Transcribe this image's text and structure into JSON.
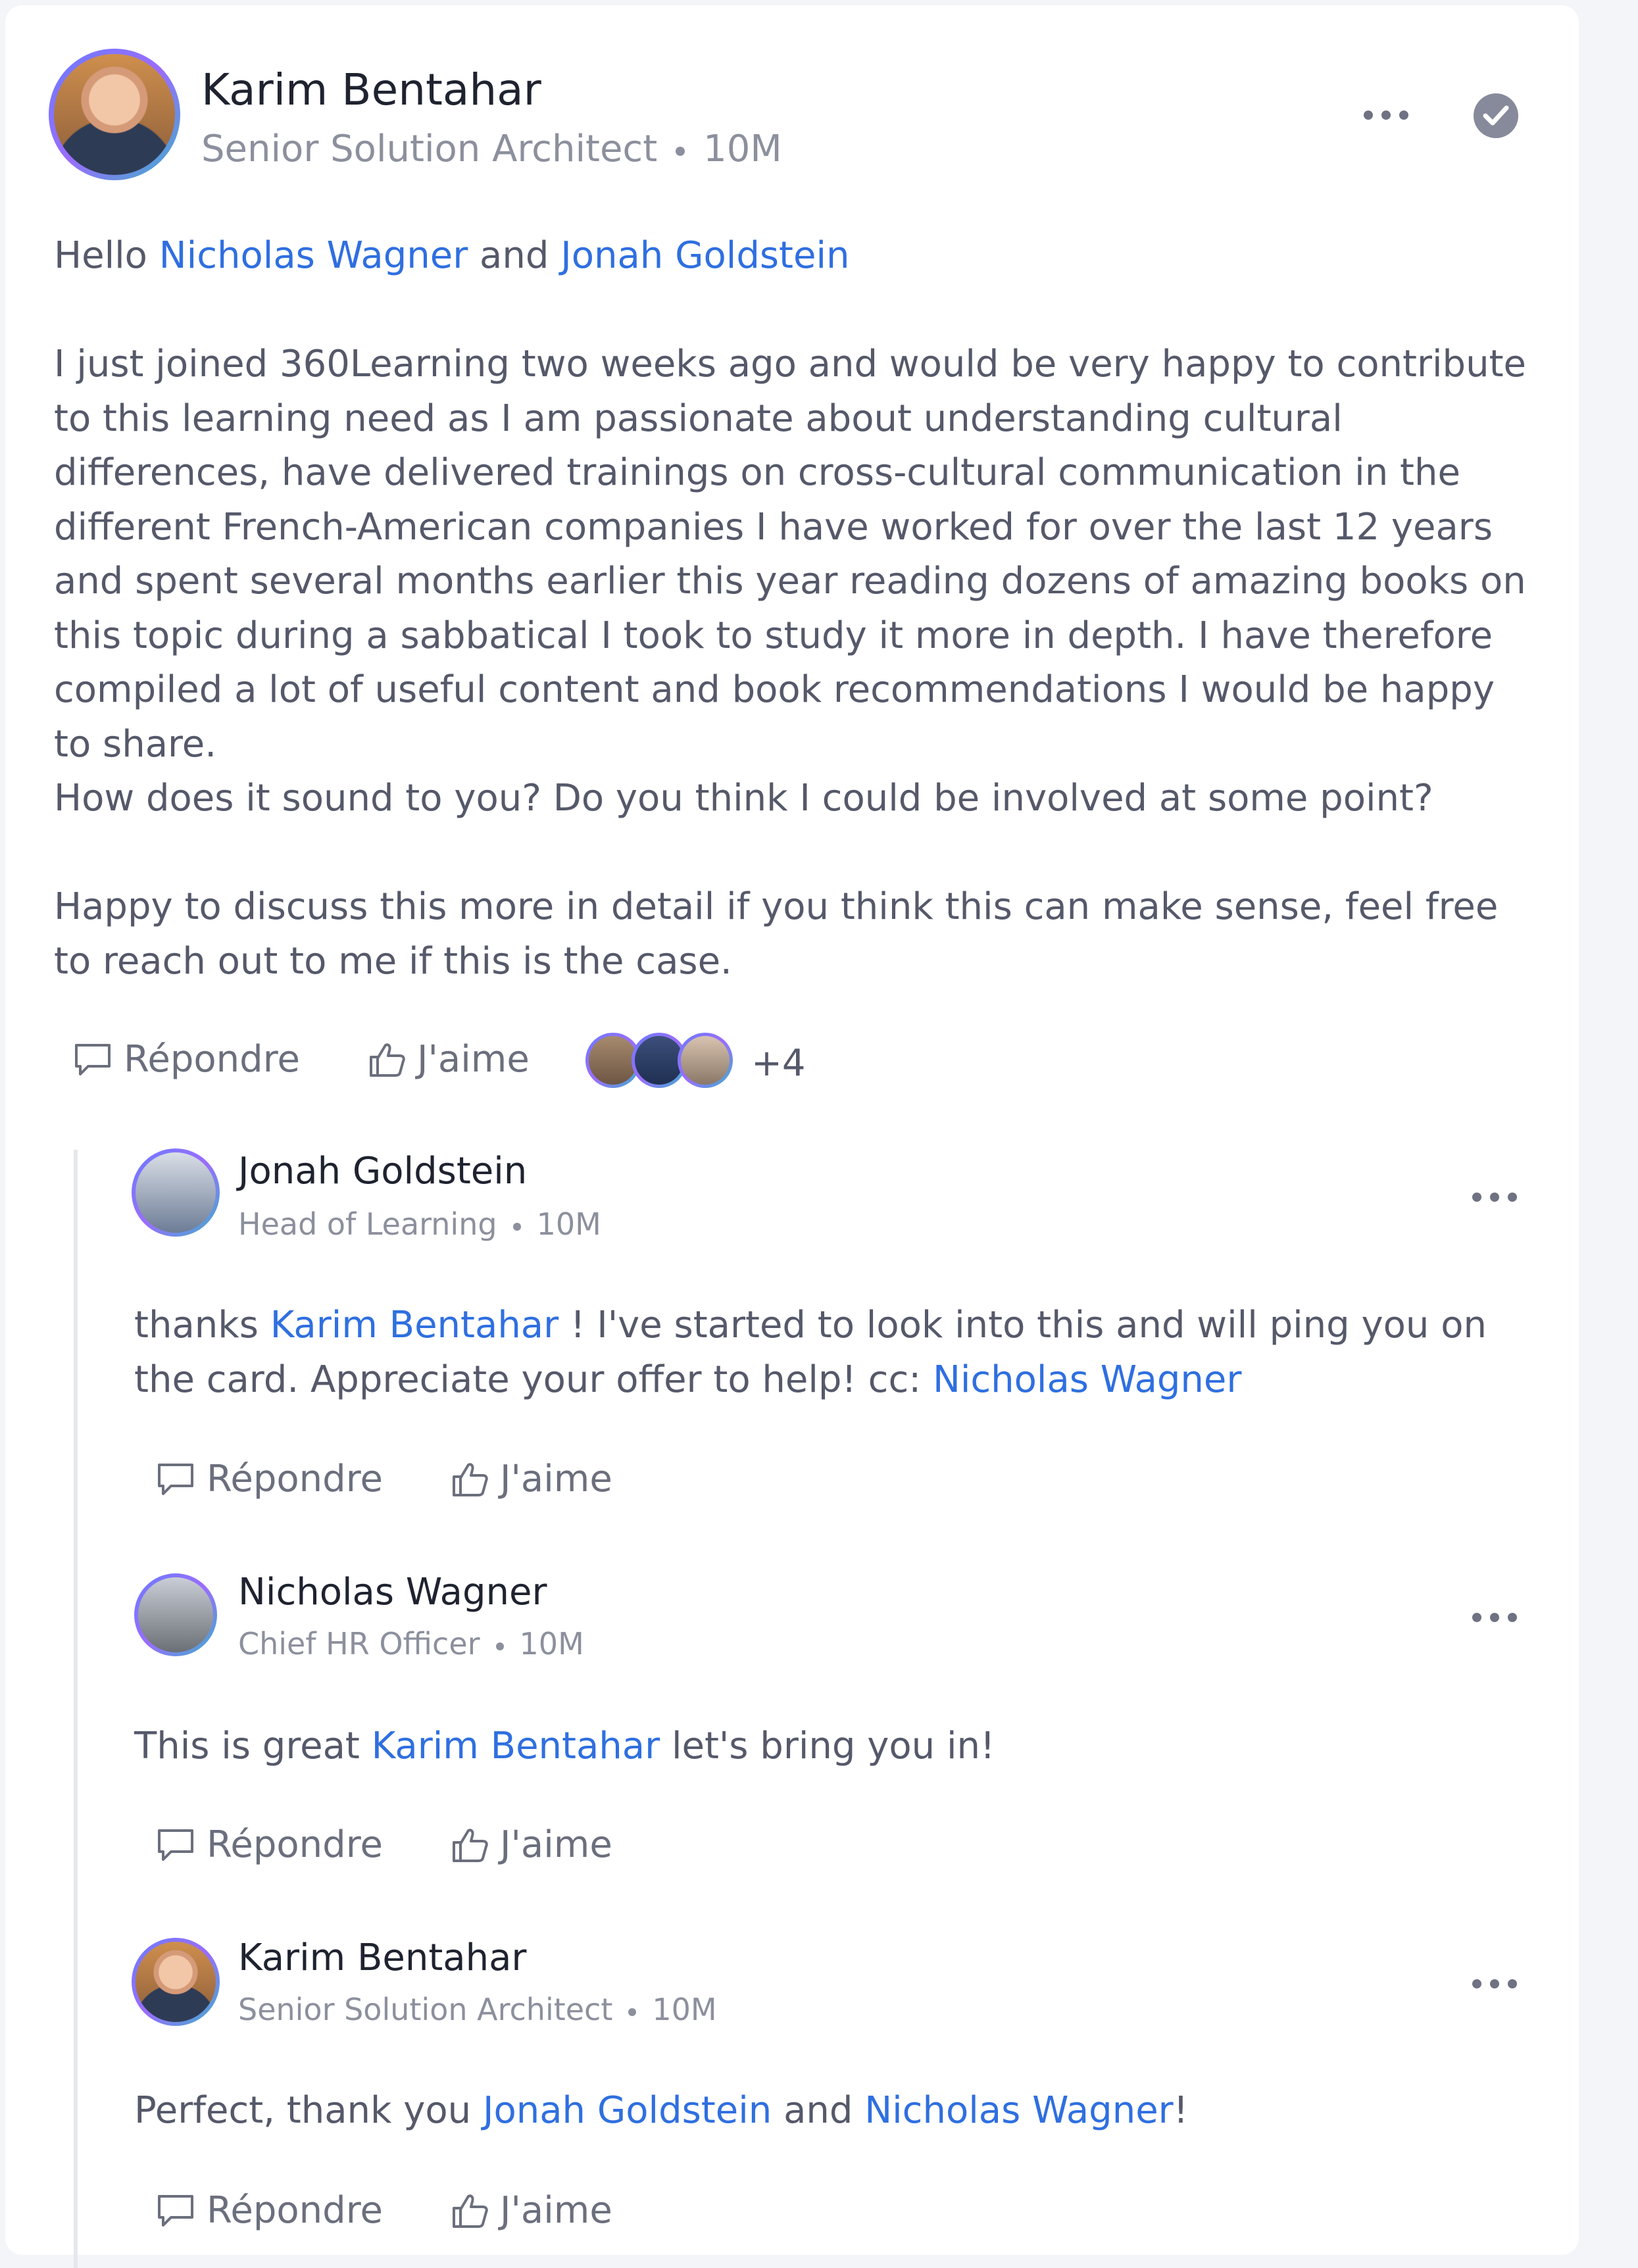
{
  "post": {
    "author": "Karim Bentahar",
    "role": "Senior Solution Architect",
    "time": "10M",
    "greeting_prefix": "Hello",
    "mention1": "Nicholas Wagner",
    "greeting_joiner": "and",
    "mention2": "Jonah Goldstein",
    "paragraph1": "I just joined 360Learning two weeks ago and would be very happy to contribute to this learning need as I am passionate about understanding cultural differences, have delivered trainings on cross-cultural communication in the different French-American companies I have worked for over the last 12 years and spent several months earlier this year reading dozens of amazing books on this topic during a sabbatical I took to study it more in depth. I have therefore compiled a lot of useful content and book recommendations I would be happy to share.",
    "paragraph2": "How does it sound to you? Do you think I could be involved at some point?",
    "paragraph3": "Happy to discuss this more in detail if you think this can make sense, feel free to reach out to me if this is the case.",
    "reply_label": "Répondre",
    "like_label": "J'aime",
    "likers_more": "+4"
  },
  "replies": [
    {
      "author": "Jonah Goldstein",
      "role": "Head of Learning",
      "time": "10M",
      "text_a": "thanks",
      "mention_a": "Karim Bentahar",
      "text_b": "! I've started to look into this and will ping you on the card. Appreciate your offer to help! cc:",
      "mention_b": "Nicholas Wagner",
      "reply_label": "Répondre",
      "like_label": "J'aime"
    },
    {
      "author": "Nicholas Wagner",
      "role": "Chief HR Officer",
      "time": "10M",
      "text_a": "This is great",
      "mention_a": "Karim Bentahar",
      "text_b": "let's bring you in!",
      "reply_label": "Répondre",
      "like_label": "J'aime"
    },
    {
      "author": "Karim Bentahar",
      "role": "Senior Solution Architect",
      "time": "10M",
      "text_a": "Perfect, thank you",
      "mention_a": "Jonah Goldstein",
      "text_b": "and",
      "mention_b": "Nicholas Wagner",
      "text_c": "!",
      "reply_label": "Répondre",
      "like_label": "J'aime"
    }
  ],
  "colors": {
    "mention": "#2f6fe0",
    "body_text": "#55596a",
    "name_text": "#1f2330",
    "meta_text": "#8c909d"
  },
  "icons": [
    "more-options-icon",
    "verified-check-icon",
    "reply-bubble-icon",
    "thumbs-up-icon"
  ]
}
